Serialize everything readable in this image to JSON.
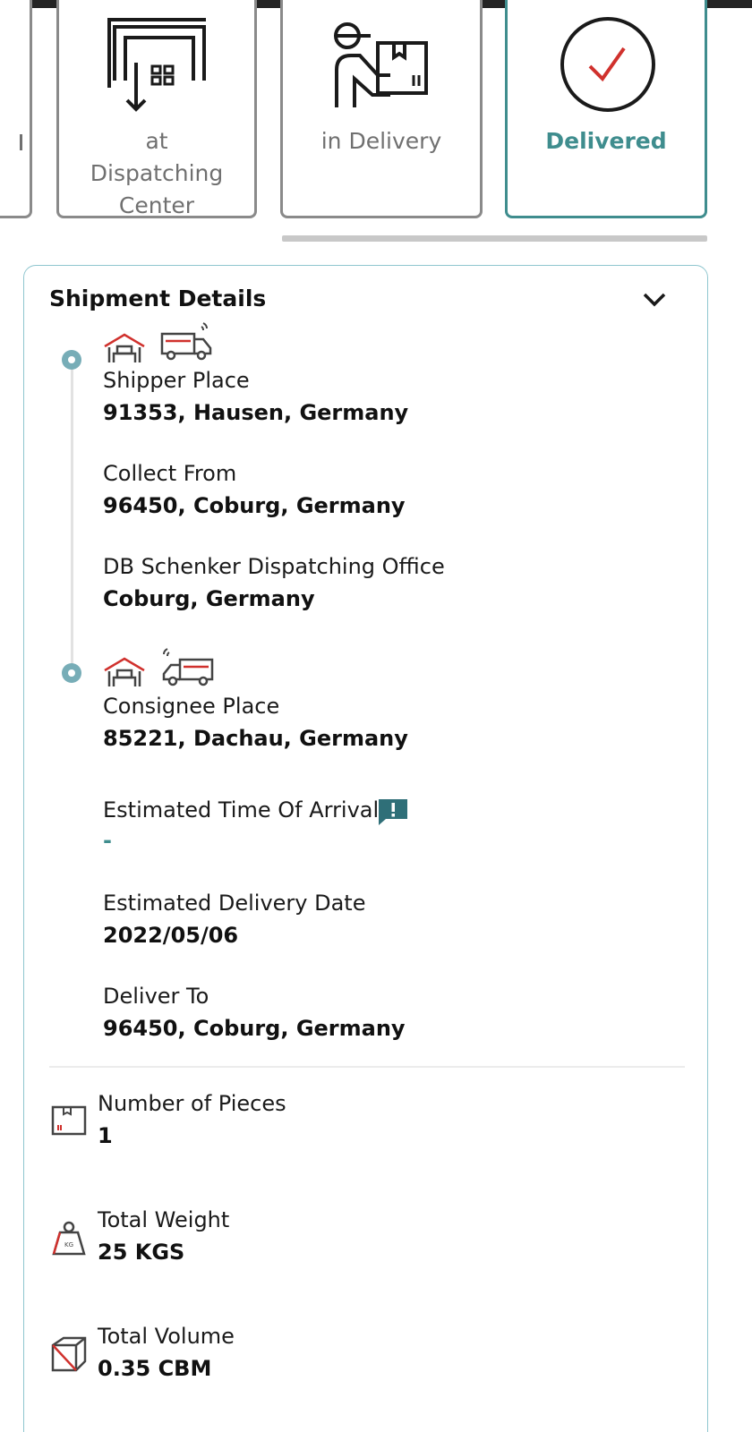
{
  "status_steps": [
    {
      "label": "at Dispatching Center",
      "icon": "warehouse-dispatch-icon",
      "active": false
    },
    {
      "label": "in Delivery",
      "icon": "delivery-person-icon",
      "active": false
    },
    {
      "label": "Delivered",
      "icon": "checkmark-circle-icon",
      "active": true
    }
  ],
  "shipment_details": {
    "title": "Shipment Details",
    "origin": {
      "shipper_place_label": "Shipper Place",
      "shipper_place_value": "91353, Hausen, Germany",
      "collect_from_label": "Collect From",
      "collect_from_value": "96450, Coburg, Germany",
      "dispatching_office_label": "DB Schenker Dispatching Office",
      "dispatching_office_value": "Coburg, Germany"
    },
    "destination": {
      "consignee_place_label": "Consignee Place",
      "consignee_place_value": "85221, Dachau, Germany",
      "eta_label": "Estimated Time Of Arrival",
      "eta_value": "-",
      "edd_label": "Estimated Delivery Date",
      "edd_value": "2022/05/06",
      "deliver_to_label": "Deliver To",
      "deliver_to_value": "96450, Coburg, Germany"
    },
    "summary": {
      "pieces_label": "Number of Pieces",
      "pieces_value": "1",
      "weight_label": "Total Weight",
      "weight_value": "25 KGS",
      "volume_label": "Total Volume",
      "volume_value": "0.35 CBM"
    }
  },
  "colors": {
    "accent": "#3f8d8e",
    "timeline_dot": "#77adb7",
    "icon_red": "#d0312d",
    "card_border": "#8a8a8a"
  }
}
